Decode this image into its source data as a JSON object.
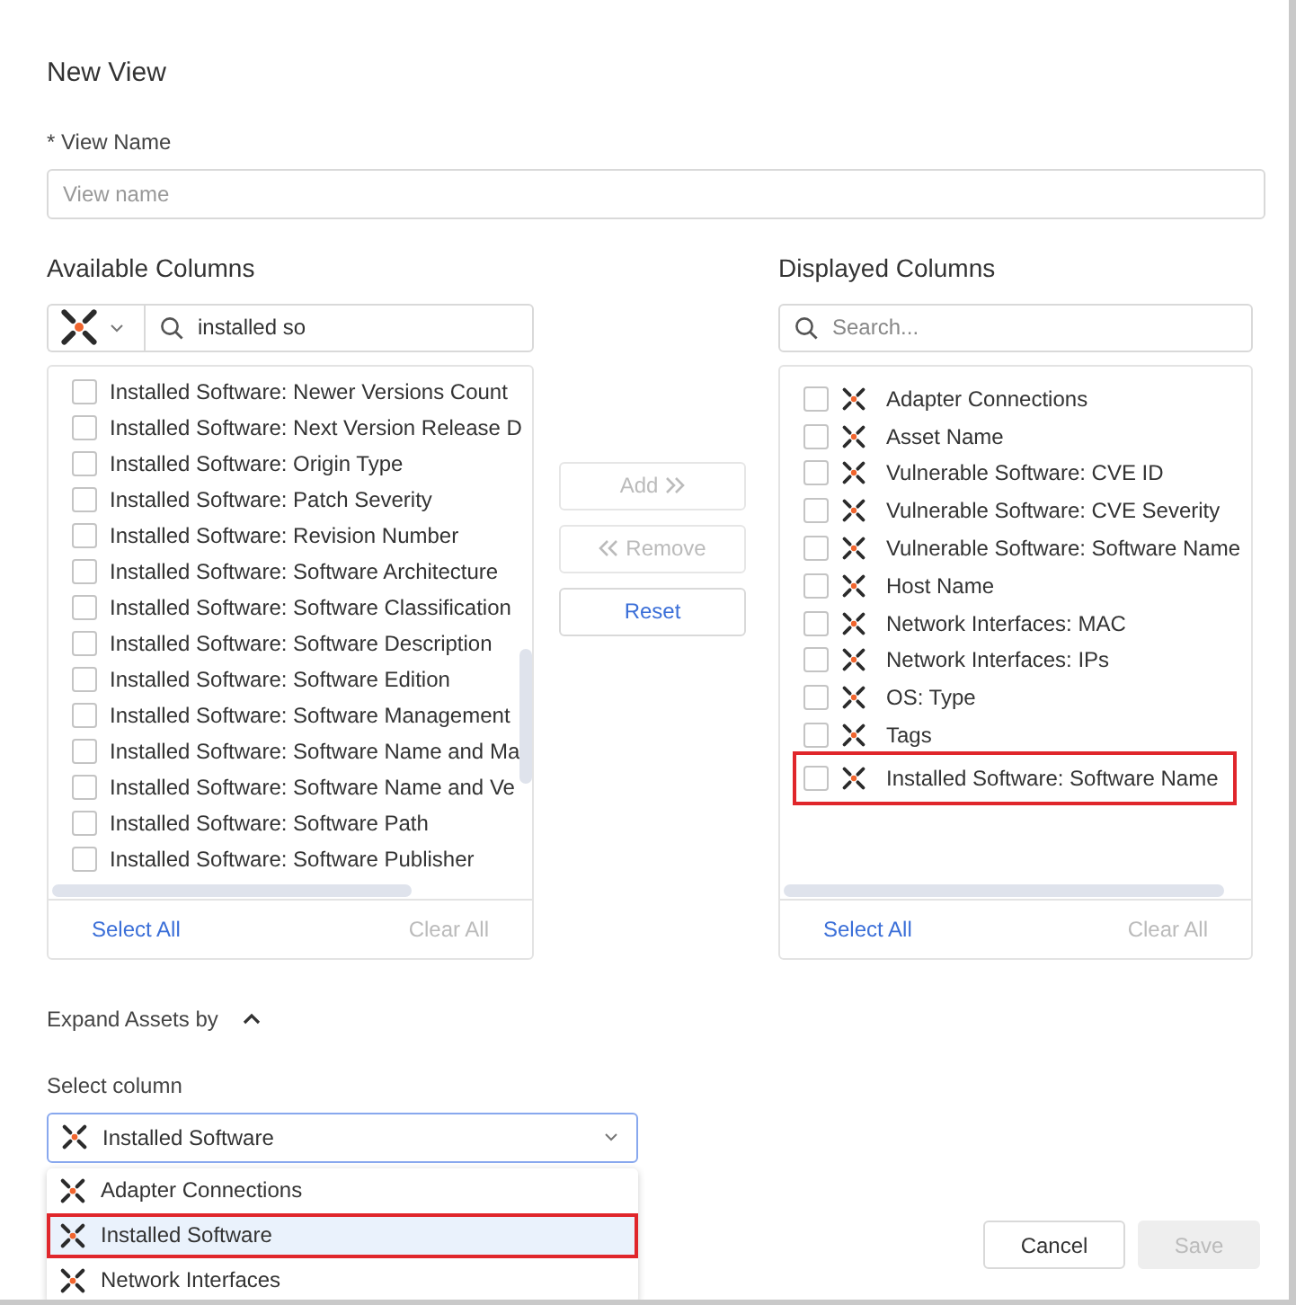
{
  "dialog": {
    "title": "New View"
  },
  "view_name": {
    "label": "* View Name",
    "placeholder": "View name"
  },
  "available_columns": {
    "heading": "Available Columns",
    "search_value": "installed so",
    "items": [
      {
        "label": "Installed Software: Newer Versions Count",
        "checked": false
      },
      {
        "label": "Installed Software: Next Version Release D",
        "checked": false
      },
      {
        "label": "Installed Software: Origin Type",
        "checked": false
      },
      {
        "label": "Installed Software: Patch Severity",
        "checked": false
      },
      {
        "label": "Installed Software: Revision Number",
        "checked": false
      },
      {
        "label": "Installed Software: Software Architecture",
        "checked": false
      },
      {
        "label": "Installed Software: Software Classification",
        "checked": false
      },
      {
        "label": "Installed Software: Software Description",
        "checked": false
      },
      {
        "label": "Installed Software: Software Edition",
        "checked": false
      },
      {
        "label": "Installed Software: Software Management",
        "checked": false
      },
      {
        "label": "Installed Software: Software Name and Ma",
        "checked": false
      },
      {
        "label": "Installed Software: Software Name and Ve",
        "checked": false
      },
      {
        "label": "Installed Software: Software Path",
        "checked": false
      },
      {
        "label": "Installed Software: Software Publisher",
        "checked": false
      }
    ],
    "select_all": {
      "label": "Select All",
      "disabled": false
    },
    "clear_all": {
      "label": "Clear All",
      "disabled": true
    }
  },
  "transfer_buttons": [
    {
      "label": "Add",
      "kind": "forward",
      "disabled": true
    },
    {
      "label": "Remove",
      "kind": "back",
      "disabled": true
    },
    {
      "label": "Reset",
      "kind": "plain",
      "disabled": false
    }
  ],
  "displayed_columns": {
    "heading": "Displayed Columns",
    "search_placeholder": "Search...",
    "items": [
      {
        "label": "Adapter Connections",
        "checked": false,
        "highlighted": false
      },
      {
        "label": "Asset Name",
        "checked": false,
        "highlighted": false
      },
      {
        "label": "Vulnerable Software: CVE ID",
        "checked": false,
        "highlighted": false
      },
      {
        "label": "Vulnerable Software: CVE Severity",
        "checked": false,
        "highlighted": false
      },
      {
        "label": "Vulnerable Software: Software Name",
        "checked": false,
        "highlighted": false
      },
      {
        "label": "Host Name",
        "checked": false,
        "highlighted": false
      },
      {
        "label": "Network Interfaces: MAC",
        "checked": false,
        "highlighted": false
      },
      {
        "label": "Network Interfaces: IPs",
        "checked": false,
        "highlighted": false
      },
      {
        "label": "OS: Type",
        "checked": false,
        "highlighted": false
      },
      {
        "label": "Tags",
        "checked": false,
        "highlighted": false
      },
      {
        "label": "Installed Software: Software Name",
        "checked": false,
        "highlighted": true
      }
    ],
    "select_all": {
      "label": "Select All",
      "disabled": false
    },
    "clear_all": {
      "label": "Clear All",
      "disabled": true
    }
  },
  "expand_assets": {
    "label": "Expand Assets by",
    "expanded": true
  },
  "select_column": {
    "label": "Select column",
    "value": "Installed Software",
    "options": [
      {
        "label": "Adapter Connections",
        "selected": false,
        "highlighted": false
      },
      {
        "label": "Installed Software",
        "selected": true,
        "highlighted": true
      },
      {
        "label": "Network Interfaces",
        "selected": false,
        "highlighted": false
      }
    ]
  },
  "footer_buttons": [
    {
      "label": "Cancel",
      "disabled": false
    },
    {
      "label": "Save",
      "disabled": true
    }
  ]
}
